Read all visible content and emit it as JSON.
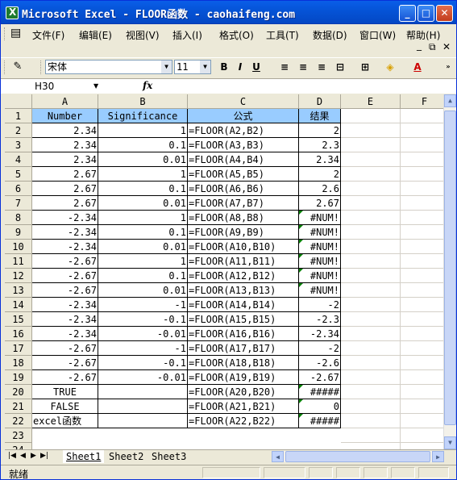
{
  "window": {
    "title": "Microsoft Excel - FLOOR函数 - caohaifeng.com"
  },
  "menu": [
    "文件(F)",
    "编辑(E)",
    "视图(V)",
    "插入(I)",
    "格式(O)",
    "工具(T)",
    "数据(D)",
    "窗口(W)",
    "帮助(H)"
  ],
  "toolbar": {
    "font": "宋体",
    "size": "11",
    "bold": "B",
    "italic": "I",
    "underline": "U",
    "font_color": "A"
  },
  "formula_bar": {
    "name_box": "H30",
    "fx": "fx",
    "formula": ""
  },
  "columns": [
    "A",
    "B",
    "C",
    "D",
    "E",
    "F"
  ],
  "rows": [
    {
      "n": "1",
      "a": "Number",
      "b": "Significance",
      "c": "公式",
      "d": "结果"
    },
    {
      "n": "2",
      "a": "2.34",
      "b": "1",
      "c": "=FLOOR(A2,B2)",
      "d": "2"
    },
    {
      "n": "3",
      "a": "2.34",
      "b": "0.1",
      "c": "=FLOOR(A3,B3)",
      "d": "2.3"
    },
    {
      "n": "4",
      "a": "2.34",
      "b": "0.01",
      "c": "=FLOOR(A4,B4)",
      "d": "2.34"
    },
    {
      "n": "5",
      "a": "2.67",
      "b": "1",
      "c": "=FLOOR(A5,B5)",
      "d": "2"
    },
    {
      "n": "6",
      "a": "2.67",
      "b": "0.1",
      "c": "=FLOOR(A6,B6)",
      "d": "2.6"
    },
    {
      "n": "7",
      "a": "2.67",
      "b": "0.01",
      "c": "=FLOOR(A7,B7)",
      "d": "2.67"
    },
    {
      "n": "8",
      "a": "-2.34",
      "b": "1",
      "c": "=FLOOR(A8,B8)",
      "d": "#NUM!"
    },
    {
      "n": "9",
      "a": "-2.34",
      "b": "0.1",
      "c": "=FLOOR(A9,B9)",
      "d": "#NUM!"
    },
    {
      "n": "10",
      "a": "-2.34",
      "b": "0.01",
      "c": "=FLOOR(A10,B10)",
      "d": "#NUM!"
    },
    {
      "n": "11",
      "a": "-2.67",
      "b": "1",
      "c": "=FLOOR(A11,B11)",
      "d": "#NUM!"
    },
    {
      "n": "12",
      "a": "-2.67",
      "b": "0.1",
      "c": "=FLOOR(A12,B12)",
      "d": "#NUM!"
    },
    {
      "n": "13",
      "a": "-2.67",
      "b": "0.01",
      "c": "=FLOOR(A13,B13)",
      "d": "#NUM!"
    },
    {
      "n": "14",
      "a": "-2.34",
      "b": "-1",
      "c": "=FLOOR(A14,B14)",
      "d": "-2"
    },
    {
      "n": "15",
      "a": "-2.34",
      "b": "-0.1",
      "c": "=FLOOR(A15,B15)",
      "d": "-2.3"
    },
    {
      "n": "16",
      "a": "-2.34",
      "b": "-0.01",
      "c": "=FLOOR(A16,B16)",
      "d": "-2.34"
    },
    {
      "n": "17",
      "a": "-2.67",
      "b": "-1",
      "c": "=FLOOR(A17,B17)",
      "d": "-2"
    },
    {
      "n": "18",
      "a": "-2.67",
      "b": "-0.1",
      "c": "=FLOOR(A18,B18)",
      "d": "-2.6"
    },
    {
      "n": "19",
      "a": "-2.67",
      "b": "-0.01",
      "c": "=FLOOR(A19,B19)",
      "d": "-2.67"
    },
    {
      "n": "20",
      "a": "TRUE",
      "b": "",
      "c": "=FLOOR(A20,B20)",
      "d": "#####"
    },
    {
      "n": "21",
      "a": "FALSE",
      "b": "",
      "c": "=FLOOR(A21,B21)",
      "d": "0"
    },
    {
      "n": "22",
      "a": "excel函数",
      "b": "",
      "c": "=FLOOR(A22,B22)",
      "d": "#####"
    },
    {
      "n": "23",
      "a": "",
      "b": "",
      "c": "",
      "d": ""
    },
    {
      "n": "24",
      "a": "",
      "b": "",
      "c": "",
      "d": ""
    }
  ],
  "sheets": [
    "Sheet1",
    "Sheet2",
    "Sheet3"
  ],
  "status": "就绪",
  "colors": {
    "header_fill": "#99ccff",
    "title_bar": "#0553d6",
    "error_marker": "#008000"
  }
}
